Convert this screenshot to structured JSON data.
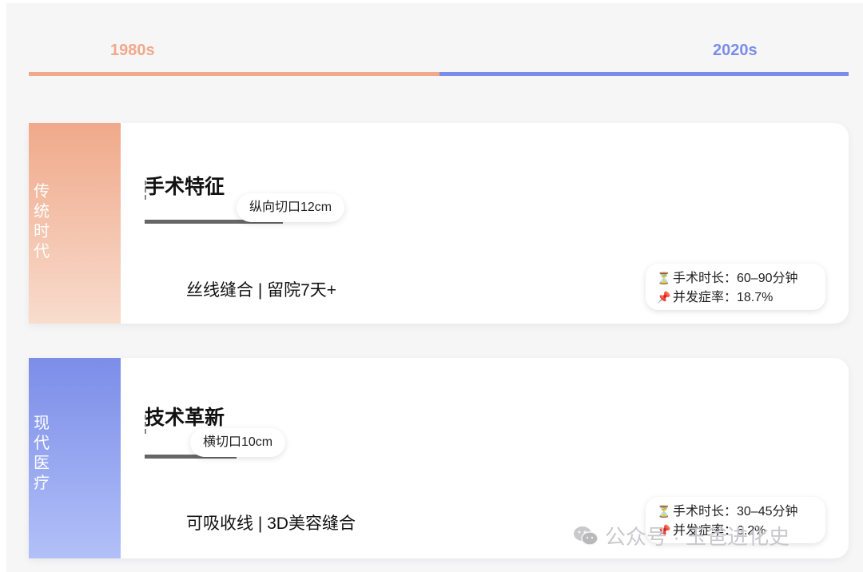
{
  "timeline": {
    "start_label": "1980s",
    "end_label": "2020s",
    "start_color": "#f0a98a",
    "end_color": "#7b8de8"
  },
  "cards": [
    {
      "side_label": "传统时代",
      "side_gradient": [
        "#f0a98a",
        "#f8dccd"
      ],
      "title": "手术特征",
      "incision": "纵向切口12cm",
      "incision_bar_fraction": 0.17,
      "feature": "丝线缝合 | 留院7天+",
      "stats": [
        {
          "icon": "hourglass-icon",
          "glyph": "⏳",
          "text": "手术时长：60–90分钟"
        },
        {
          "icon": "pushpin-icon",
          "glyph": "📌",
          "text": "并发症率：18.7%"
        }
      ]
    },
    {
      "side_label": "现代医疗",
      "side_gradient": [
        "#7b8de8",
        "#b2c0f8"
      ],
      "title": "技术革新",
      "incision": "横切口10cm",
      "incision_bar_fraction": 0.11,
      "feature": "可吸收线 | 3D美容缝合",
      "stats": [
        {
          "icon": "hourglass-icon",
          "glyph": "⏳",
          "text": "手术时长：30–45分钟"
        },
        {
          "icon": "pushpin-icon",
          "glyph": "📌",
          "text": "并发症率：6.2%"
        }
      ]
    }
  ],
  "watermark": {
    "text": "公众号 · 玉爸进化史",
    "icon": "wechat-icon"
  }
}
